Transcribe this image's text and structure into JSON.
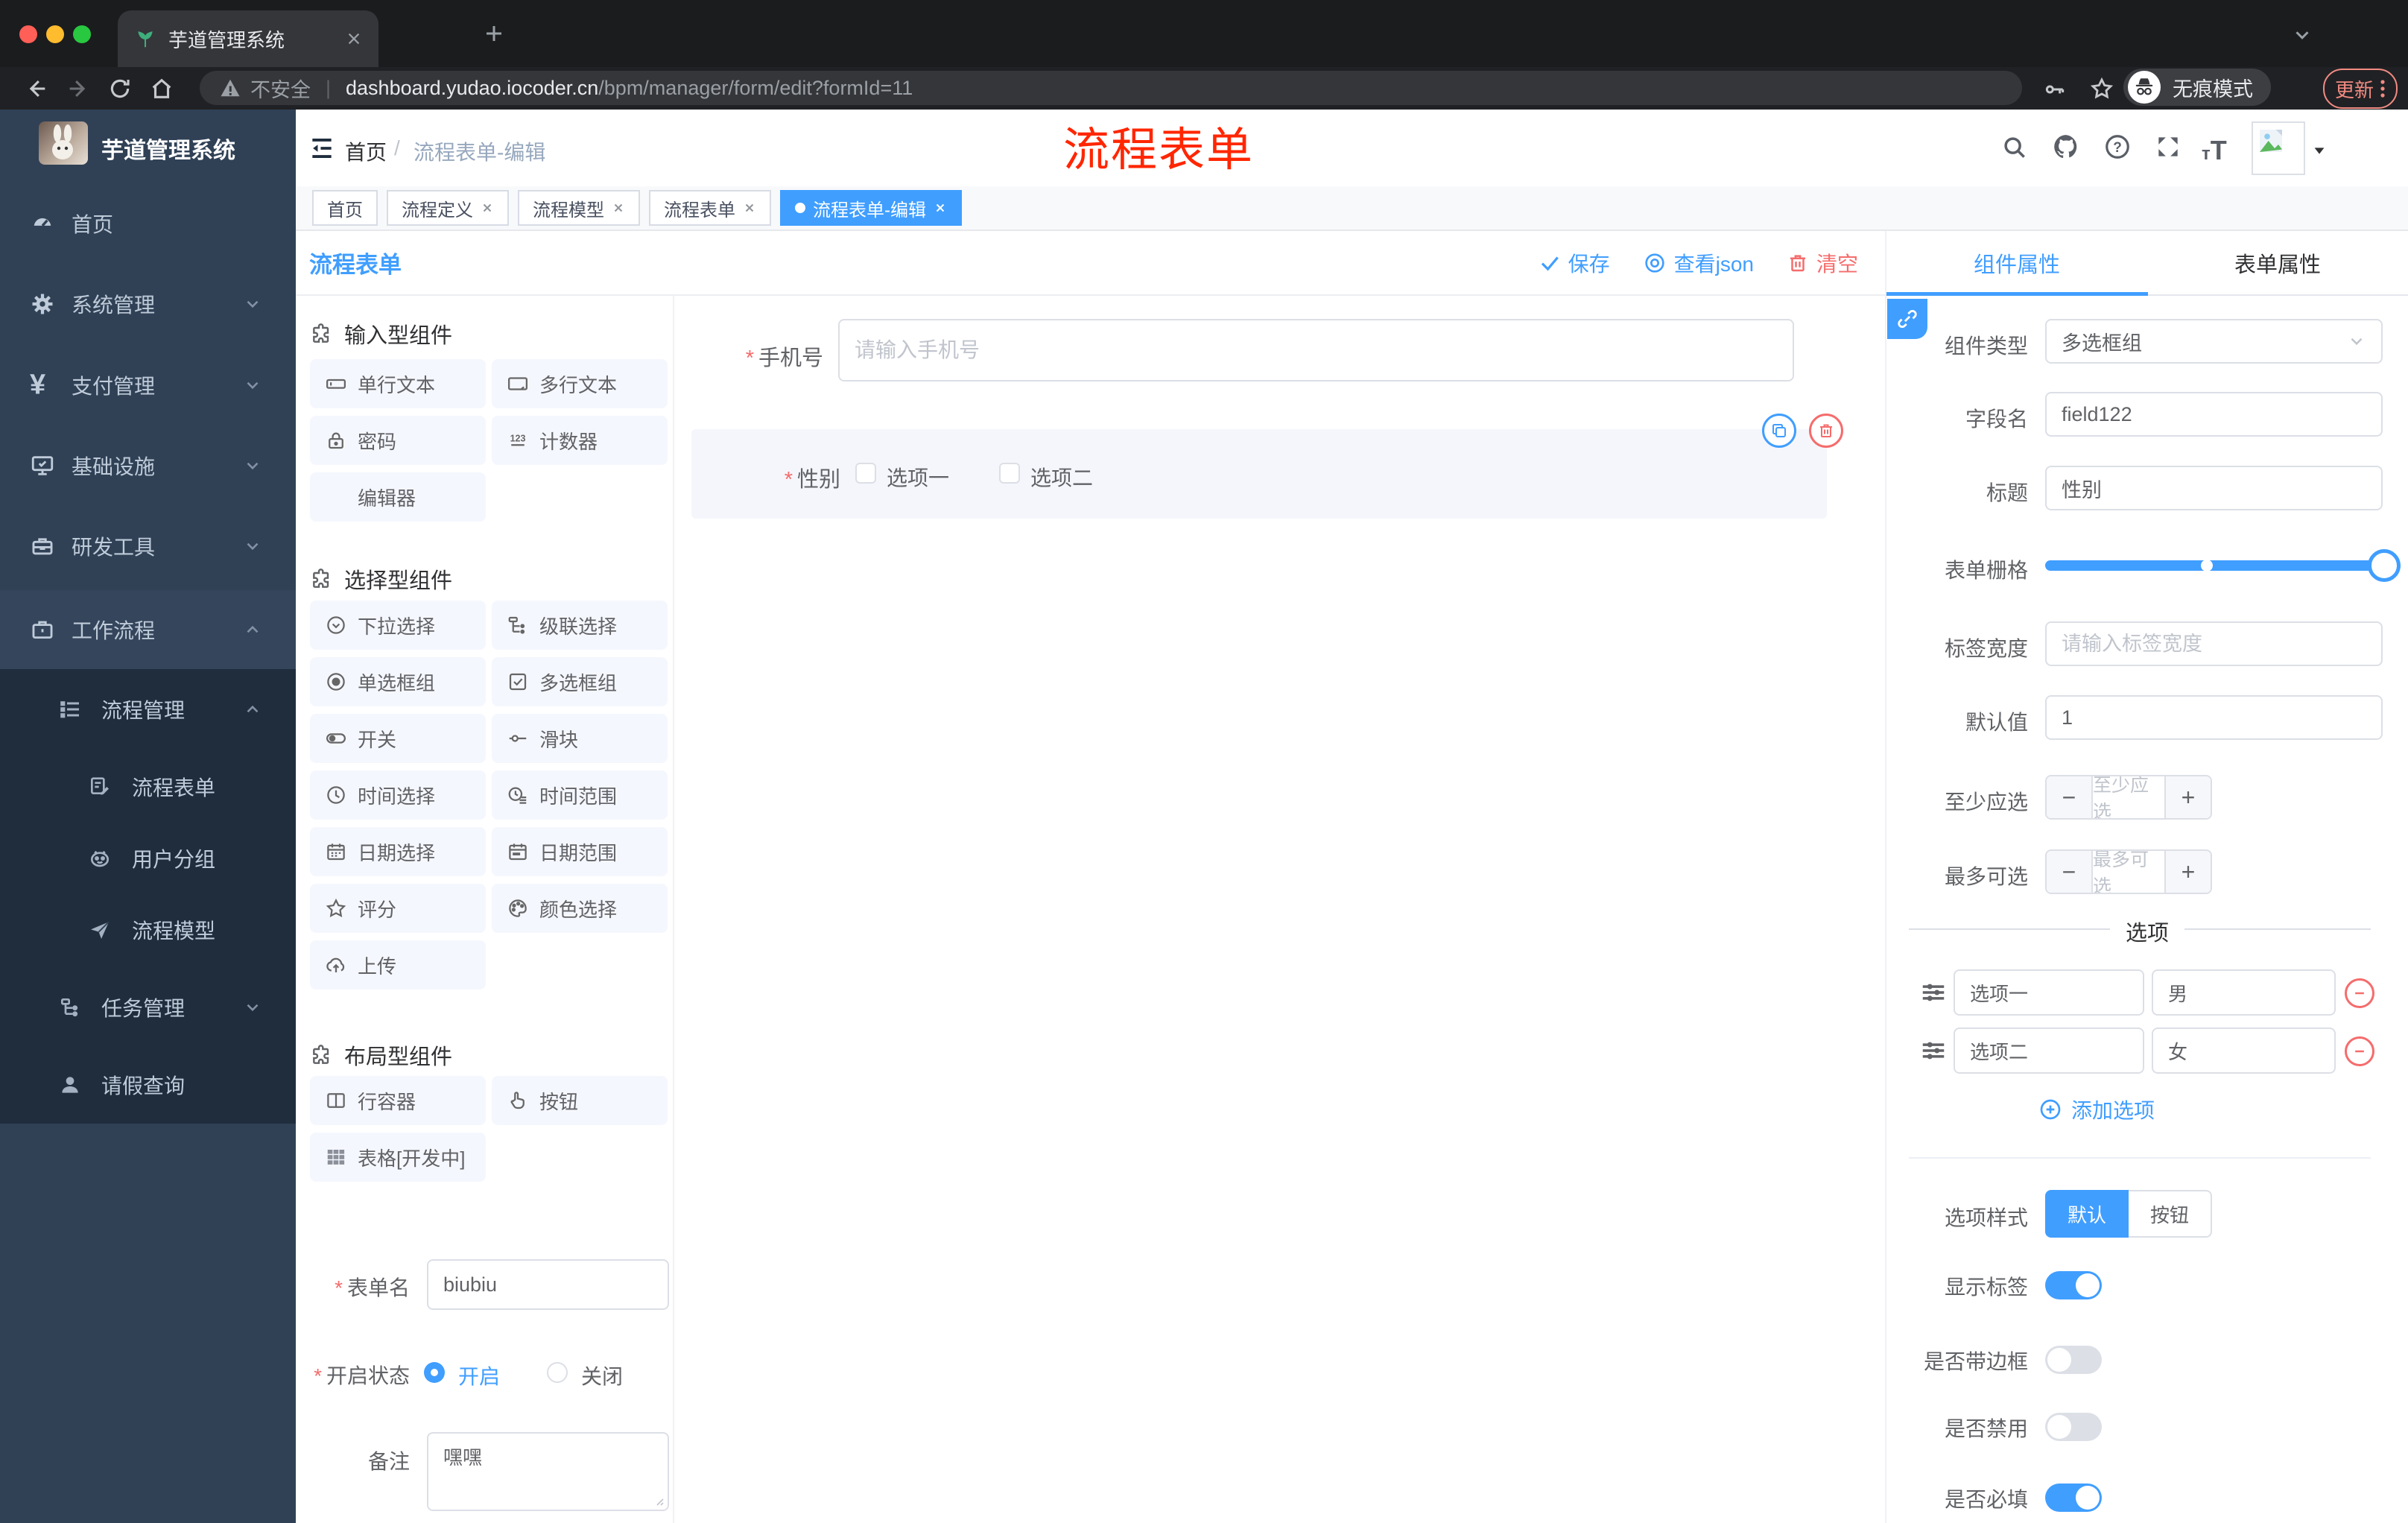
{
  "browser": {
    "tab_title": "芋道管理系统",
    "security_label": "不安全",
    "url_host": "dashboard.yudao.iocoder.cn",
    "url_path": "/bpm/manager/form/edit?formId=11",
    "incognito_label": "无痕模式",
    "update_label": "更新"
  },
  "sidebar": {
    "app_title": "芋道管理系统",
    "items": [
      {
        "label": "首页"
      },
      {
        "label": "系统管理"
      },
      {
        "label": "支付管理"
      },
      {
        "label": "基础设施"
      },
      {
        "label": "研发工具"
      },
      {
        "label": "工作流程"
      },
      {
        "label": "流程管理"
      },
      {
        "label": "流程表单"
      },
      {
        "label": "用户分组"
      },
      {
        "label": "流程模型"
      },
      {
        "label": "任务管理"
      },
      {
        "label": "请假查询"
      }
    ]
  },
  "navbar": {
    "breadcrumb": [
      "首页",
      "流程表单-编辑"
    ],
    "separator": "/"
  },
  "annotation": "流程表单",
  "tags": {
    "items": [
      {
        "label": "首页"
      },
      {
        "label": "流程定义"
      },
      {
        "label": "流程模型"
      },
      {
        "label": "流程表单"
      },
      {
        "label": "流程表单-编辑"
      }
    ]
  },
  "designer": {
    "title": "流程表单",
    "save": "保存",
    "view_json": "查看json",
    "clear": "清空"
  },
  "components": {
    "input_group": {
      "title": "输入型组件",
      "items": [
        {
          "label": "单行文本"
        },
        {
          "label": "多行文本"
        },
        {
          "label": "密码"
        },
        {
          "label": "计数器"
        },
        {
          "label": "编辑器"
        }
      ]
    },
    "select_group": {
      "title": "选择型组件",
      "items": [
        {
          "label": "下拉选择"
        },
        {
          "label": "级联选择"
        },
        {
          "label": "单选框组"
        },
        {
          "label": "多选框组"
        },
        {
          "label": "开关"
        },
        {
          "label": "滑块"
        },
        {
          "label": "时间选择"
        },
        {
          "label": "时间范围"
        },
        {
          "label": "日期选择"
        },
        {
          "label": "日期范围"
        },
        {
          "label": "评分"
        },
        {
          "label": "颜色选择"
        },
        {
          "label": "上传"
        }
      ]
    },
    "layout_group": {
      "title": "布局型组件",
      "items": [
        {
          "label": "行容器"
        },
        {
          "label": "按钮"
        },
        {
          "label": "表格[开发中]"
        }
      ]
    }
  },
  "form_meta": {
    "name_label": "表单名",
    "name_value": "biubiu",
    "status_label": "开启状态",
    "status_options": [
      "开启",
      "关闭"
    ],
    "remark_label": "备注",
    "remark_value": "嘿嘿"
  },
  "canvas": {
    "phone": {
      "label": "手机号",
      "placeholder": "请输入手机号"
    },
    "gender": {
      "label": "性别",
      "options": [
        "选项一",
        "选项二"
      ]
    }
  },
  "props": {
    "tabs": [
      "组件属性",
      "表单属性"
    ],
    "component_type": {
      "label": "组件类型",
      "value": "多选框组"
    },
    "field_name": {
      "label": "字段名",
      "value": "field122"
    },
    "title": {
      "label": "标题",
      "value": "性别"
    },
    "grid": {
      "label": "表单栅格"
    },
    "label_width": {
      "label": "标签宽度",
      "placeholder": "请输入标签宽度"
    },
    "default_value": {
      "label": "默认值",
      "value": "1"
    },
    "min_select": {
      "label": "至少应选",
      "placeholder": "至少应选"
    },
    "max_select": {
      "label": "最多可选",
      "placeholder": "最多可选"
    },
    "options_title": "选项",
    "options": [
      {
        "label": "选项一",
        "value": "男"
      },
      {
        "label": "选项二",
        "value": "女"
      }
    ],
    "add_option": "添加选项",
    "option_style": {
      "label": "选项样式",
      "options": [
        "默认",
        "按钮"
      ],
      "selected": "默认"
    },
    "show_label": {
      "label": "显示标签",
      "on": true
    },
    "border": {
      "label": "是否带边框",
      "on": false
    },
    "disabled": {
      "label": "是否禁用",
      "on": false
    },
    "required": {
      "label": "是否必填",
      "on": true
    }
  },
  "colors": {
    "primary": "#409eff",
    "danger": "#f56c6c",
    "sidebar_bg": "#304156",
    "submenu_bg": "#1f2d3d"
  }
}
